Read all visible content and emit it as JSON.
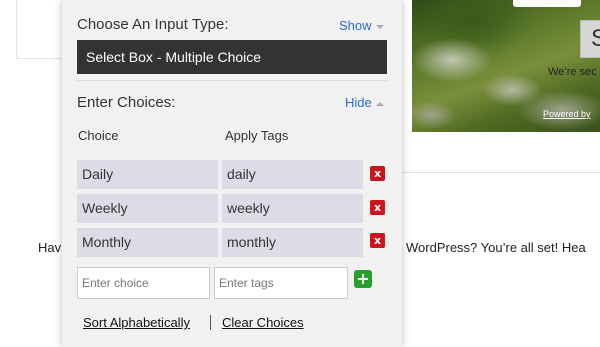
{
  "background": {
    "hav_text": "Hav",
    "wordpress_text": "WordPress? You’re all set! Hea",
    "search_button_label": "S",
    "were_text": "We’re sec",
    "powered_text": "Powered by"
  },
  "input_type": {
    "title": "Choose An Input Type:",
    "toggle_label": "Show",
    "selected": "Select Box - Multiple Choice"
  },
  "choices": {
    "title": "Enter Choices:",
    "toggle_label": "Hide",
    "col_choice": "Choice",
    "col_tags": "Apply Tags",
    "rows": [
      {
        "choice": "Daily",
        "tags": "daily"
      },
      {
        "choice": "Weekly",
        "tags": "weekly"
      },
      {
        "choice": "Monthly",
        "tags": "monthly"
      }
    ],
    "delete_glyph": "x",
    "choice_placeholder": "Enter choice",
    "tags_placeholder": "Enter tags",
    "add_glyph": "+"
  },
  "actions": {
    "sort_label": "Sort Alphabetically",
    "clear_label": "Clear Choices"
  },
  "colors": {
    "accent": "#2a6dce",
    "delete": "#c8161e",
    "add": "#2aa02a"
  }
}
